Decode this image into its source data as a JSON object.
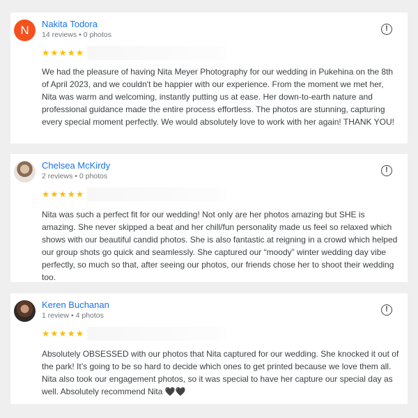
{
  "reviews": [
    {
      "avatar_letter": "N",
      "name": "Nakita Todora",
      "meta": "14 reviews • 0 photos",
      "stars": "★★★★★",
      "text": "We had the pleasure of having Nita Meyer Photography for our wedding in Pukehina on the 8th of April 2023, and we couldn't be happier with our experience. From the moment we met her, Nita was warm and welcoming, instantly putting us at ease. Her down-to-earth nature and professional guidance made the entire process effortless. The photos are stunning, capturing every special moment perfectly. We would absolutely love to work with her again! THANK YOU!"
    },
    {
      "name": "Chelsea McKirdy",
      "meta": "2 reviews • 0 photos",
      "stars": "★★★★★",
      "text": "Nita was such a perfect fit for our wedding! Not only are her photos amazing but SHE is amazing. She never skipped a beat and her chill/fun personality made us feel so relaxed which shows with our beautiful candid photos. She is also fantastic at reigning in a crowd which helped our group shots go quick and seamlessly. She captured our “moody” winter wedding day vibe perfectly, so much so that, after seeing our photos, our friends chose her to shoot their wedding too."
    },
    {
      "name": "Keren Buchanan",
      "meta": "1 review • 4 photos",
      "stars": "★★★★★",
      "text": "Absolutely OBSESSED with our photos that Nita captured for our wedding. She knocked it out of the park! It’s going to be so hard to decide which ones to get printed because we love them all. Nita also took our engagement photos, so it was special to have her capture our special day as well. Absolutely recommend Nita 🖤🖤"
    }
  ],
  "flag_icon": "report-icon",
  "flag_glyph": "!",
  "colors": {
    "name": "#1a73e8",
    "stars": "#fbbc04",
    "avatar_bg": "#f4511e"
  }
}
